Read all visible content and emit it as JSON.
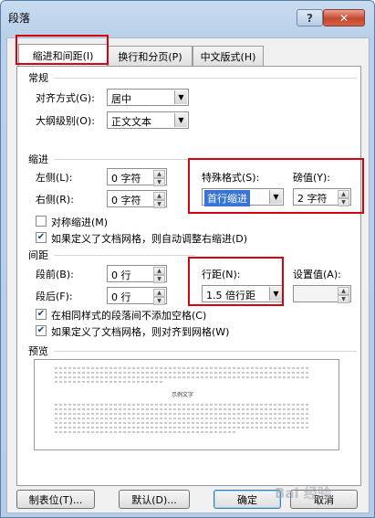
{
  "window": {
    "title": "段落",
    "help_label": "?",
    "close_label": "✕"
  },
  "tabs": [
    {
      "label": "缩进和间距(I)",
      "active": true
    },
    {
      "label": "换行和分页(P)",
      "active": false
    },
    {
      "label": "中文版式(H)",
      "active": false
    }
  ],
  "general": {
    "section_label": "常规",
    "alignment_label": "对齐方式(G):",
    "alignment_value": "居中",
    "outline_label": "大纲级别(O):",
    "outline_value": "正文文本"
  },
  "indent": {
    "section_label": "缩进",
    "left_label": "左侧(L):",
    "left_value": "0 字符",
    "right_label": "右侧(R):",
    "right_value": "0 字符",
    "special_label": "特殊格式(S):",
    "special_value": "首行缩进",
    "by_label": "磅值(Y):",
    "by_value": "2 字符",
    "mirror_label": "对称缩进(M)",
    "mirror_checked": false,
    "auto_adjust_label": "如果定义了文档网格，则自动调整右缩进(D)",
    "auto_adjust_checked": true
  },
  "spacing": {
    "section_label": "间距",
    "before_label": "段前(B):",
    "before_value": "0 行",
    "after_label": "段后(F):",
    "after_value": "0 行",
    "line_label": "行距(N):",
    "line_value": "1.5 倍行距",
    "at_label": "设置值(A):",
    "at_value": "",
    "no_space_label": "在相同样式的段落间不添加空格(C)",
    "no_space_checked": true,
    "snap_grid_label": "如果定义了文档网格，则对齐到网格(W)",
    "snap_grid_checked": true
  },
  "preview": {
    "section_label": "预览",
    "sample_text": "示例文字"
  },
  "buttons": {
    "tabs_label": "制表位(T)...",
    "default_label": "默认(D)...",
    "ok_label": "确定",
    "cancel_label": "取消"
  },
  "check_mark": "✔",
  "dropdown_arrow": "▼",
  "spin_up": "▲",
  "spin_down": "▼",
  "watermark": "Bai 经验",
  "colors": {
    "highlight_red": "#d9000f",
    "selection_blue": "#3875d7"
  }
}
